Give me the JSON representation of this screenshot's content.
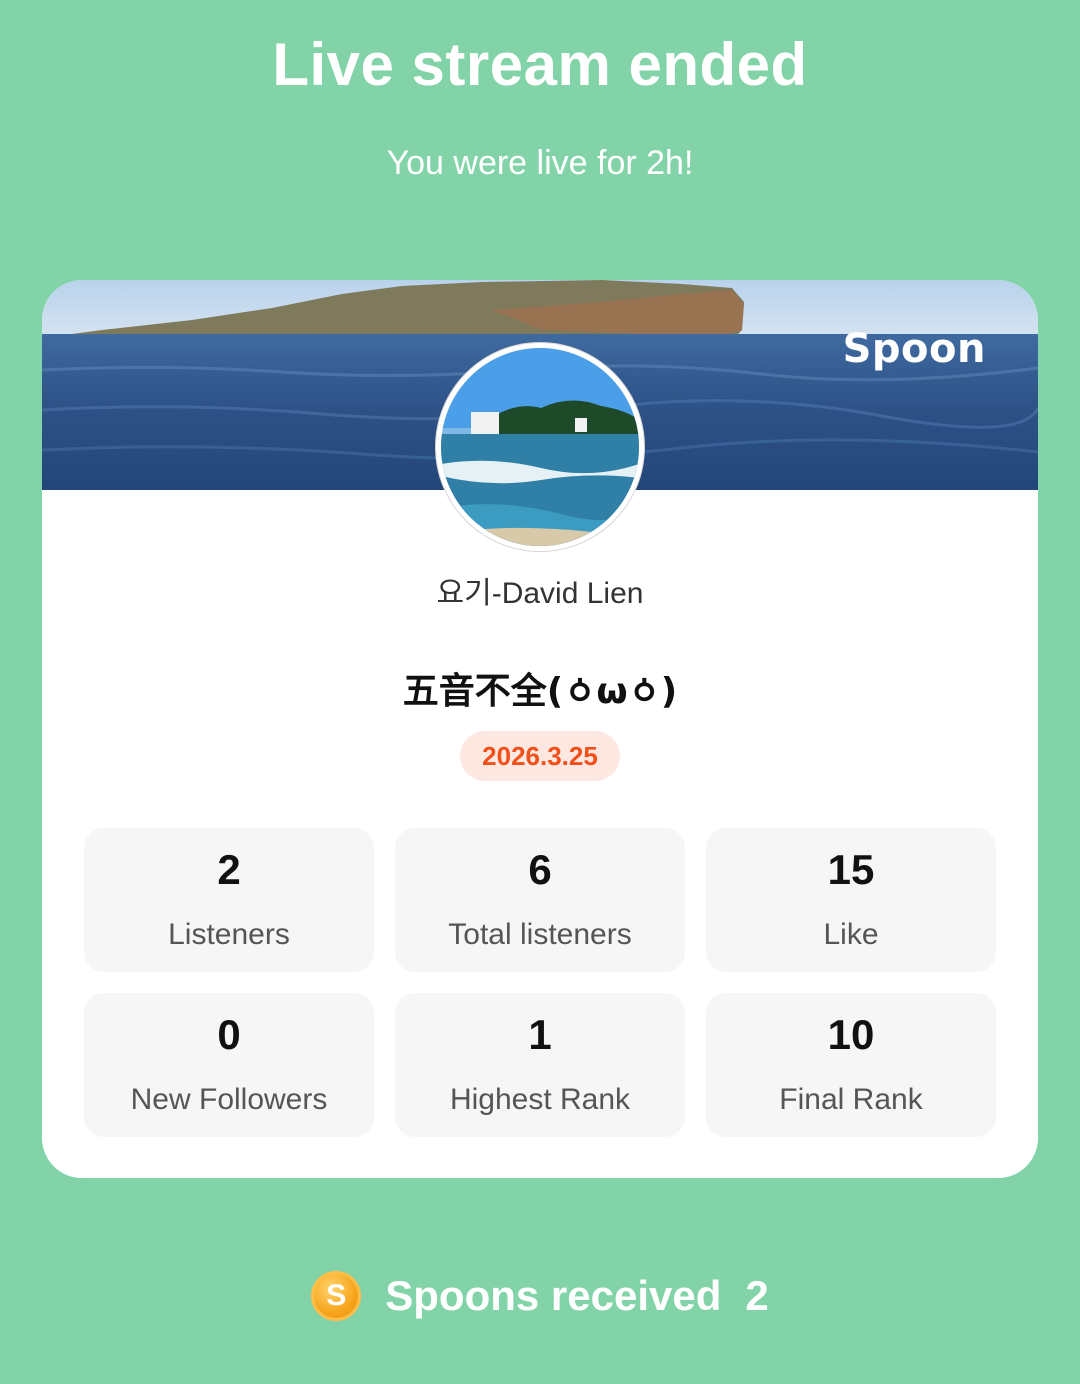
{
  "header": {
    "title": "Live stream ended",
    "subtitle": "You were live for 2h!"
  },
  "card": {
    "brand": "Spoon",
    "username": "요기-David Lien",
    "stream_title": "五音不全(ㆁωㆁ)",
    "date": "2026.3.25",
    "stats": [
      {
        "value": "2",
        "label": "Listeners"
      },
      {
        "value": "6",
        "label": "Total listeners"
      },
      {
        "value": "15",
        "label": "Like"
      },
      {
        "value": "0",
        "label": "New Followers"
      },
      {
        "value": "1",
        "label": "Highest Rank"
      },
      {
        "value": "10",
        "label": "Final Rank"
      }
    ]
  },
  "footer": {
    "coin_symbol": "S",
    "spoons_label": "Spoons received",
    "spoons_count": "2"
  },
  "colors": {
    "background": "#82d4a8",
    "date_accent": "#f0501a",
    "coin": "#f7a51c"
  }
}
